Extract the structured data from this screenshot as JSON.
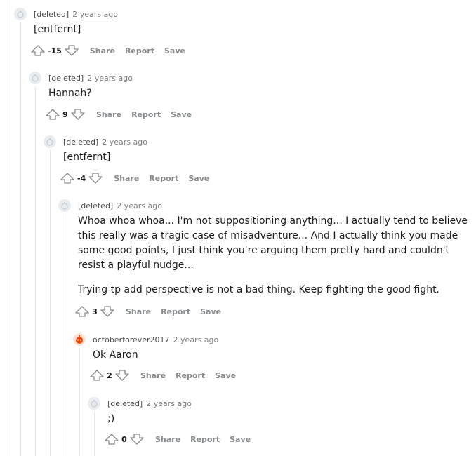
{
  "comments": [
    {
      "author": "[deleted]",
      "age": "2 years ago",
      "body": [
        "[entfernt]"
      ],
      "score": "-15"
    },
    {
      "author": "[deleted]",
      "age": "2 years ago",
      "body": [
        "Hannah?"
      ],
      "score": "9"
    },
    {
      "author": "[deleted]",
      "age": "2 years ago",
      "body": [
        "[entfernt]"
      ],
      "score": "-4"
    },
    {
      "author": "[deleted]",
      "age": "2 years ago",
      "body": [
        "Whoa whoa whoa... I'm not suppositioning anything... I actually tend to believe this really was a tragic case of misadventure... And I actually think you made some good points, I just think you're arguing them pretty hard and couldn't resist a playful nudge...",
        "Trying tp add perspective is not a bad thing. Keep fighting the good fight."
      ],
      "score": "3"
    },
    {
      "author": "octoberforever2017",
      "age": "2 years ago",
      "body": [
        "Ok Aaron"
      ],
      "score": "2"
    },
    {
      "author": "[deleted]",
      "age": "2 years ago",
      "body": [
        ";)"
      ],
      "score": "0"
    }
  ],
  "actions": {
    "share": "Share",
    "report": "Report",
    "save": "Save"
  },
  "icons": {
    "upvote": "upvote-arrow-icon",
    "downvote": "downvote-arrow-icon",
    "deleted_avatar": "snoo-avatar-icon",
    "user_avatar": "snoo-orange-avatar-icon"
  },
  "colors": {
    "accent_avatar": "#ff4500",
    "action_text": "#878a8c",
    "thread_line": "#e6e6e6"
  }
}
